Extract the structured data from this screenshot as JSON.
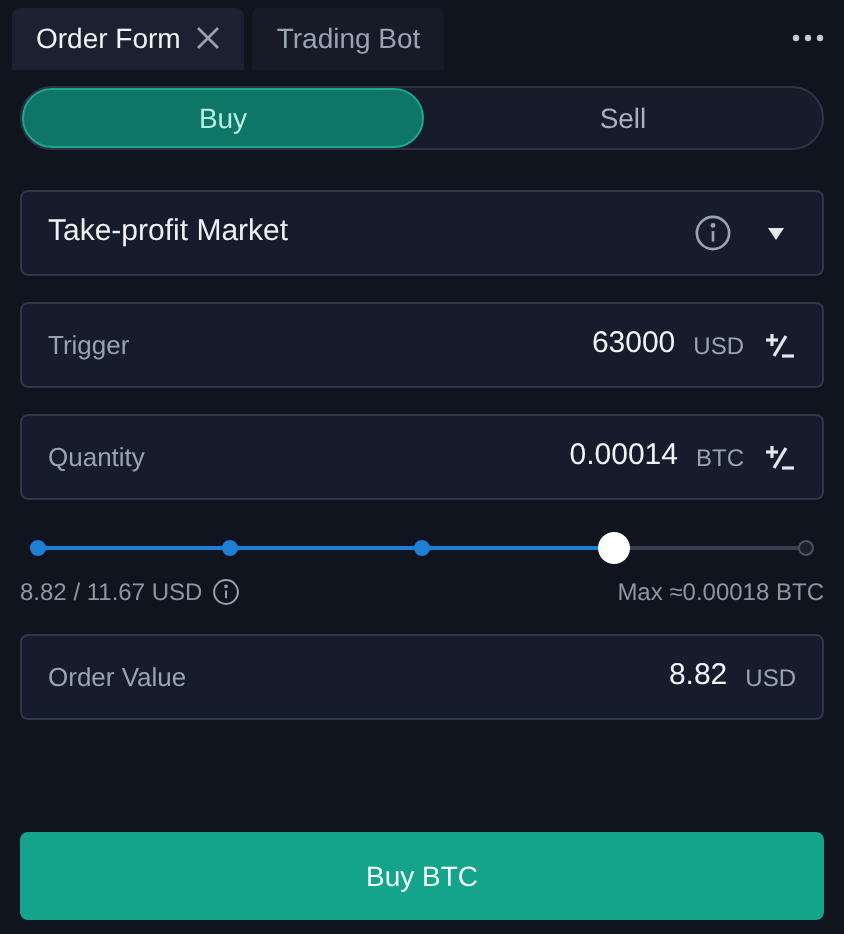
{
  "tabs": [
    {
      "label": "Order Form",
      "selected": true,
      "closable": true
    },
    {
      "label": "Trading Bot",
      "selected": false,
      "closable": false
    }
  ],
  "side_toggle": [
    {
      "label": "Buy",
      "selected": true
    },
    {
      "label": "Sell",
      "selected": false
    }
  ],
  "order_type": {
    "value": "Take-profit Market"
  },
  "fields": [
    {
      "label": "Trigger",
      "value": "63000",
      "unit": "USD",
      "adjustable": true
    },
    {
      "label": "Quantity",
      "value": "0.00014",
      "unit": "BTC",
      "adjustable": true
    }
  ],
  "slider": {
    "level": 0.75,
    "used": "8.82 / 11.67 USD",
    "max": "Max ≈0.00018 BTC"
  },
  "order_value": {
    "label": "Order Value",
    "value": "8.82",
    "unit": "USD"
  },
  "submit": "Buy BTC"
}
